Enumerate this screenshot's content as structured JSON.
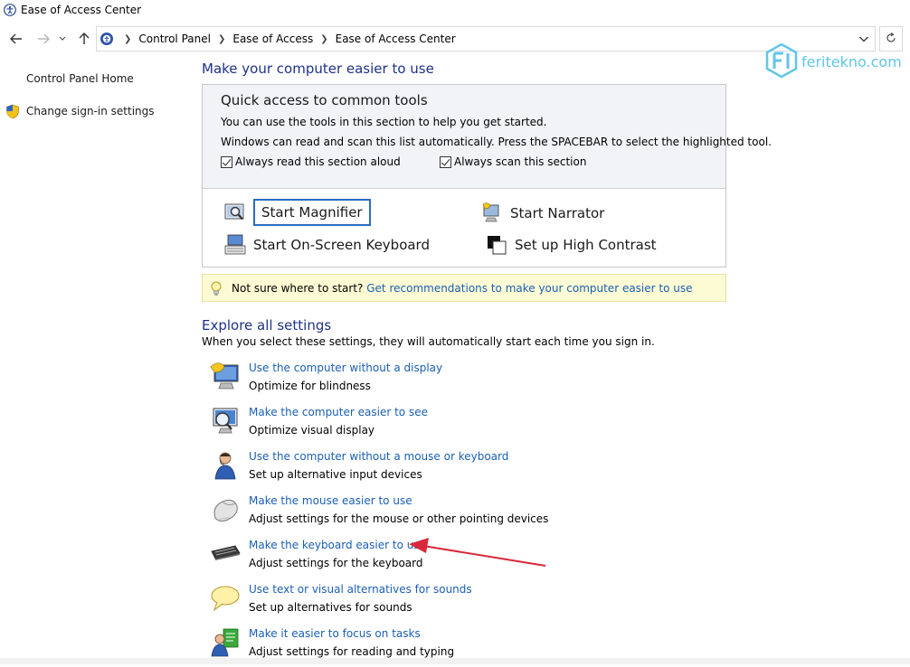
{
  "window": {
    "title": "Ease of Access Center"
  },
  "address": {
    "crumbs": [
      "Control Panel",
      "Ease of Access",
      "Ease of Access Center"
    ]
  },
  "left_nav": {
    "home": "Control Panel Home",
    "signin": "Change sign-in settings"
  },
  "watermark": {
    "text": "feritekno.com"
  },
  "main": {
    "title": "Make your computer easier to use",
    "quick_access": {
      "title": "Quick access to common tools",
      "line1": "You can use the tools in this section to help you get started.",
      "line2": "Windows can read and scan this list automatically.  Press the SPACEBAR to select the highlighted tool.",
      "check_read": "Always read this section aloud",
      "check_scan": "Always scan this section",
      "tools": {
        "magnifier": "Start Magnifier",
        "narrator": "Start Narrator",
        "osk": "Start On-Screen Keyboard",
        "contrast": "Set up High Contrast"
      }
    },
    "tip": {
      "text": "Not sure where to start?",
      "link": "Get recommendations to make your computer easier to use"
    },
    "explore": {
      "title": "Explore all settings",
      "desc": "When you select these settings, they will automatically start each time you sign in.",
      "items": [
        {
          "link": "Use the computer without a display",
          "desc": "Optimize for blindness"
        },
        {
          "link": "Make the computer easier to see",
          "desc": "Optimize visual display"
        },
        {
          "link": "Use the computer without a mouse or keyboard",
          "desc": "Set up alternative input devices"
        },
        {
          "link": "Make the mouse easier to use",
          "desc": "Adjust settings for the mouse or other pointing devices"
        },
        {
          "link": "Make the keyboard easier to use",
          "desc": "Adjust settings for the keyboard"
        },
        {
          "link": "Use text or visual alternatives for sounds",
          "desc": "Set up alternatives for sounds"
        },
        {
          "link": "Make it easier to focus on tasks",
          "desc": "Adjust settings for reading and typing"
        }
      ]
    }
  },
  "colors": {
    "heading": "#1e3287",
    "link": "#1a5fb4",
    "annotation_arrow": "#d8283a"
  }
}
